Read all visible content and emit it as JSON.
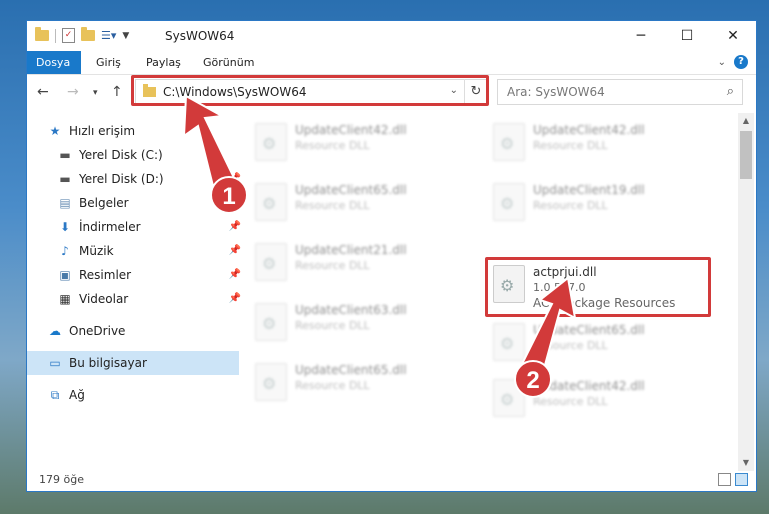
{
  "window": {
    "title": "SysWOW64"
  },
  "ribbon": {
    "tabs": [
      "Dosya",
      "Giriş",
      "Paylaş",
      "Görünüm"
    ]
  },
  "address": {
    "path": "C:\\Windows\\SysWOW64"
  },
  "search": {
    "placeholder": "Ara: SysWOW64"
  },
  "sidebar": {
    "items": [
      {
        "label": "Hızlı erişim",
        "icon": "star-icon"
      },
      {
        "label": "Yerel Disk (C:)",
        "icon": "drive-icon"
      },
      {
        "label": "Yerel Disk (D:)",
        "icon": "drive-icon"
      },
      {
        "label": "Belgeler",
        "icon": "documents-icon"
      },
      {
        "label": "İndirmeler",
        "icon": "download-icon"
      },
      {
        "label": "Müzik",
        "icon": "music-icon"
      },
      {
        "label": "Resimler",
        "icon": "pictures-icon"
      },
      {
        "label": "Videolar",
        "icon": "video-icon"
      },
      {
        "label": "OneDrive",
        "icon": "cloud-icon"
      },
      {
        "label": "Bu bilgisayar",
        "icon": "computer-icon"
      },
      {
        "label": "Ağ",
        "icon": "network-icon"
      }
    ]
  },
  "files": {
    "left": [
      {
        "name": "UpdateClient42.dll",
        "desc": "Resource DLL"
      },
      {
        "name": "UpdateClient65.dll",
        "desc": "Resource DLL"
      },
      {
        "name": "UpdateClient21.dll",
        "desc": "Resource DLL"
      },
      {
        "name": "UpdateClient63.dll",
        "desc": "Resource DLL"
      },
      {
        "name": "UpdateClient65.dll",
        "desc": "Resource DLL"
      }
    ],
    "right": [
      {
        "name": "UpdateClient42.dll",
        "desc": "Resource DLL"
      },
      {
        "name": "UpdateClient19.dll",
        "desc": "Resource DLL"
      },
      {
        "name": "UpdateClient65.dll",
        "desc": "Resource DLL"
      },
      {
        "name": "UpdateClient42.dll",
        "desc": "Resource DLL"
      }
    ],
    "highlighted": {
      "name": "actprjui.dll",
      "version": "1.0.527.0",
      "desc": "ACT Package Resources"
    }
  },
  "status": {
    "count": "179 öğe"
  },
  "annotations": {
    "step1": "1",
    "step2": "2"
  },
  "colors": {
    "accent": "#1979ca",
    "highlight": "#d23a3a"
  }
}
